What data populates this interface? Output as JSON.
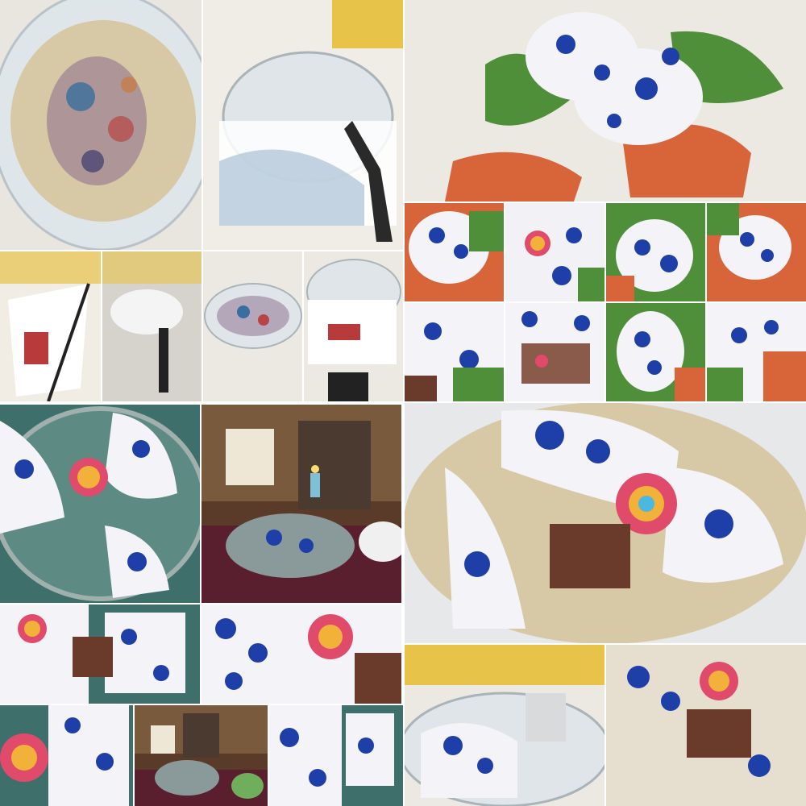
{
  "collage": {
    "tile_count": 29,
    "palette": {
      "porcelain_white": "#f4f4f8",
      "cobalt_blue": "#1f3fa8",
      "glass": "#d9e3ea",
      "newspaper": "#d8c9a6",
      "silk_green": "#4f8f3a",
      "silk_orange": "#d8643a",
      "tray_teal": "#3f6f6a",
      "wall_yellow": "#e8c34a",
      "tablecloth_burgundy": "#5a1f2e"
    }
  }
}
